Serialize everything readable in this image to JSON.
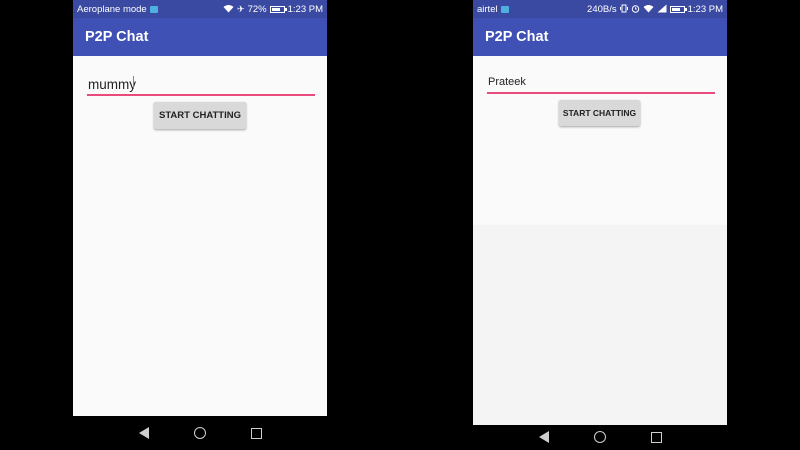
{
  "phones": [
    {
      "status_bar": {
        "left_text": "Aeroplane mode",
        "time": "1:23 PM",
        "battery_text": "72%",
        "battery_level": 0.72
      },
      "app_title": "P2P Chat",
      "name_field_value": "mummy",
      "start_button_label": "START CHATTING",
      "nav": {
        "back_icon": "back-icon",
        "home_icon": "home-icon",
        "recents_icon": "recents-icon"
      }
    },
    {
      "status_bar": {
        "left_text": "airtel",
        "speed_text": "240B/s",
        "time": "1:23 PM",
        "battery_level": 0.7
      },
      "app_title": "P2P Chat",
      "name_field_value": "Prateek",
      "start_button_label": "START CHATTING",
      "nav": {
        "back_icon": "back-icon",
        "home_icon": "home-icon",
        "recents_icon": "recents-icon"
      }
    }
  ],
  "colors": {
    "status_bar": "#3a4aa3",
    "app_bar": "#3f51b5",
    "accent_underline": "#e94b7d",
    "button_bg": "#d9d9d9",
    "content_bg": "#fafafa"
  }
}
